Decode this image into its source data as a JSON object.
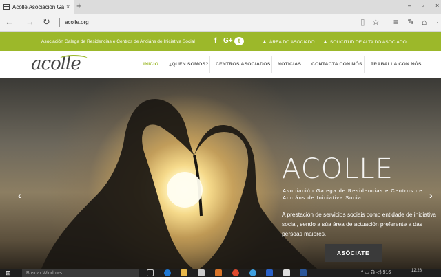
{
  "browser": {
    "tab_title": "Acolle Asociación Galeg",
    "tab_close": "×",
    "new_tab": "+",
    "url": "acolle.org",
    "back": "←",
    "forward": "→",
    "refresh": "↻"
  },
  "topbar": {
    "association_name": "Asociación Galega de Residencias e Centros de Anciáns de Iniciativa Social",
    "social": [
      "f",
      "G+",
      "t"
    ],
    "members_area": "ÁREA DO ASOCIADO",
    "membership_request": "SOLICITUD DE ALTA DO ASOCIADO"
  },
  "header": {
    "logo": "acolle",
    "menu": [
      "INICIO",
      "¿QUEN SOMOS?",
      "CENTROS ASOCIADOS",
      "NOTICIAS",
      "CONTACTA CON NÓS",
      "TRABALLA CON NÓS"
    ]
  },
  "hero": {
    "title": "ACOLLE",
    "subtitle": "Asociación Galega de Residencias e Centros de Anciáns de Iniciativa Social",
    "text": "A prestación de servicios sociais como entidade de iniciativa social, sendo a súa área de actuación preferente a das persoas maiores.",
    "button": "ASÓCIATE",
    "prev": "‹",
    "next": "›"
  },
  "taskbar": {
    "search_placeholder": "Buscar Windows",
    "tray": "^ ▭ ☊ ◁) 916",
    "clock": "12:28"
  },
  "colors": {
    "brand_green": "#9cb82a",
    "button_dark": "#3a3a3a"
  }
}
